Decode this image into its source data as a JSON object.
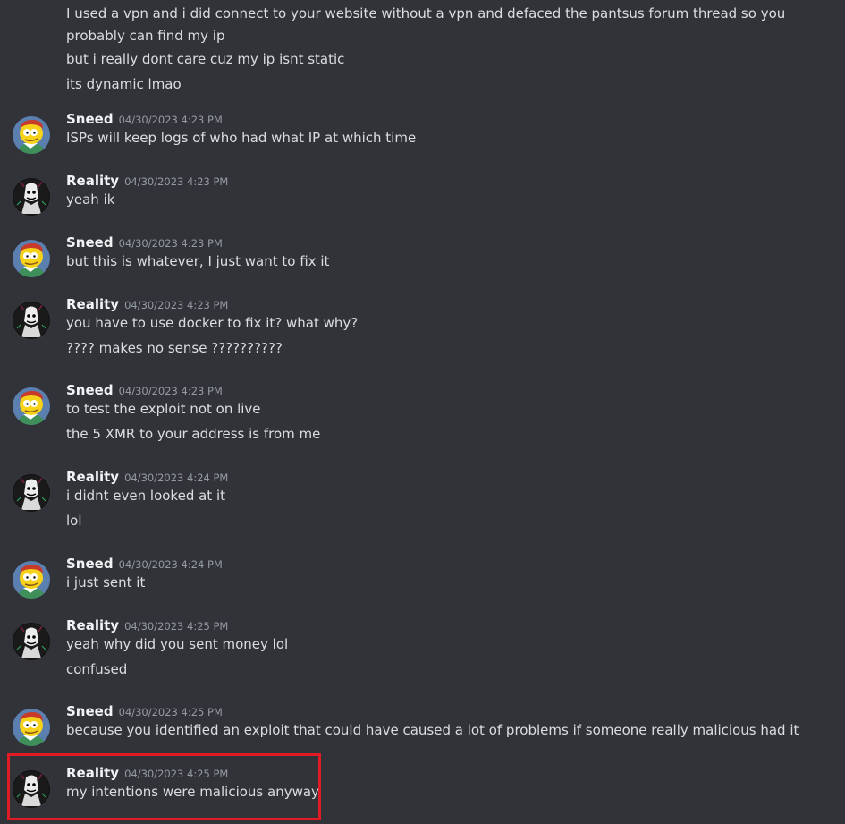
{
  "chat": {
    "top_lines": [
      "I used a vpn and i did connect to your website without a vpn and defaced the pantsus forum thread so you probably can find my ip",
      "but i really dont care cuz my ip isnt static",
      "its dynamic lmao"
    ],
    "messages": [
      {
        "author": "Sneed",
        "avatar": "sneed-avatar-icon",
        "timestamp": "04/30/2023 4:23 PM",
        "lines": [
          "ISPs will keep logs of who had what IP at which time"
        ]
      },
      {
        "author": "Reality",
        "avatar": "reality-avatar-icon",
        "timestamp": "04/30/2023 4:23 PM",
        "lines": [
          "yeah ik"
        ]
      },
      {
        "author": "Sneed",
        "avatar": "sneed-avatar-icon",
        "timestamp": "04/30/2023 4:23 PM",
        "lines": [
          "but this is whatever, I just want to fix it"
        ]
      },
      {
        "author": "Reality",
        "avatar": "reality-avatar-icon",
        "timestamp": "04/30/2023 4:23 PM",
        "lines": [
          "you have to use docker to fix it? what why?",
          "???? makes no sense ??????????"
        ]
      },
      {
        "author": "Sneed",
        "avatar": "sneed-avatar-icon",
        "timestamp": "04/30/2023 4:23 PM",
        "lines": [
          "to test the exploit not on live",
          "the 5 XMR to your address is from me"
        ]
      },
      {
        "author": "Reality",
        "avatar": "reality-avatar-icon",
        "timestamp": "04/30/2023 4:24 PM",
        "lines": [
          "i didnt even looked at it",
          "lol"
        ]
      },
      {
        "author": "Sneed",
        "avatar": "sneed-avatar-icon",
        "timestamp": "04/30/2023 4:24 PM",
        "lines": [
          "i just sent it"
        ]
      },
      {
        "author": "Reality",
        "avatar": "reality-avatar-icon",
        "timestamp": "04/30/2023 4:25 PM",
        "lines": [
          "yeah why did you sent money lol",
          "confused"
        ]
      },
      {
        "author": "Sneed",
        "avatar": "sneed-avatar-icon",
        "timestamp": "04/30/2023 4:25 PM",
        "lines": [
          "because you identified an exploit that could have caused a lot of problems if someone really malicious had it"
        ]
      },
      {
        "author": "Reality",
        "avatar": "reality-avatar-icon",
        "timestamp": "04/30/2023 4:25 PM",
        "lines": [
          "my intentions were malicious anyway"
        ],
        "highlighted": true
      }
    ]
  },
  "colors": {
    "background": "#313338",
    "username": "#f2f3f5",
    "message_text": "#dbdee1",
    "timestamp": "#949ba4",
    "highlight_border": "#e01b24"
  }
}
